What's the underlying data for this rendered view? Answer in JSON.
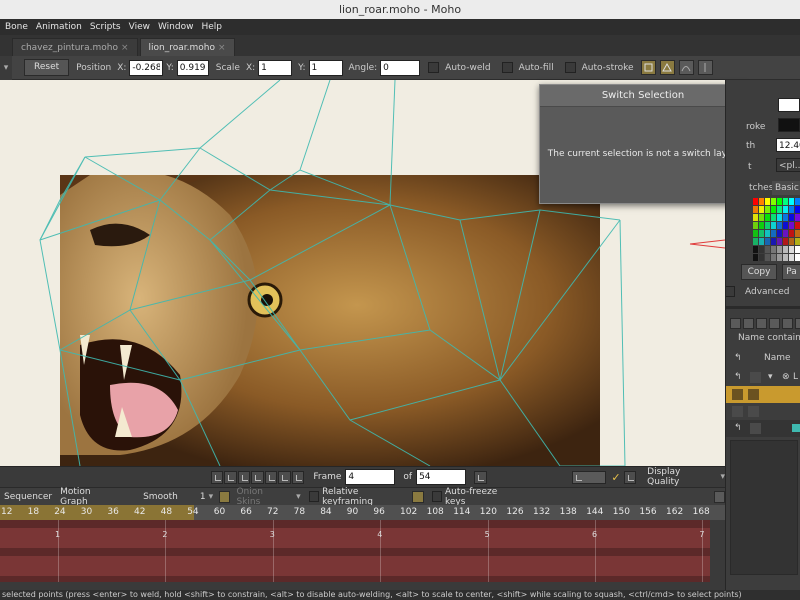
{
  "window": {
    "title": "lion_roar.moho - Moho"
  },
  "menu": [
    "Bone",
    "Animation",
    "Scripts",
    "View",
    "Window",
    "Help"
  ],
  "doc_tabs": [
    {
      "label": "chavez_pintura.moho",
      "active": false
    },
    {
      "label": "lion_roar.moho",
      "active": true
    }
  ],
  "tool_options": {
    "reset_label": "Reset",
    "position_label": "Position",
    "x_label": "X:",
    "position_x": "-0.2688",
    "y_label": "Y:",
    "position_y": "0.9199",
    "scale_label": "Scale",
    "scale_x": "1",
    "scale_y": "1",
    "angle_label": "Angle:",
    "angle": "0",
    "auto_weld": "Auto-weld",
    "auto_fill": "Auto-fill",
    "auto_stroke": "Auto-stroke"
  },
  "dialog": {
    "title": "Switch Selection",
    "message": "The current selection is not a switch layer.",
    "close_icon": "close-icon"
  },
  "style_panel": {
    "stroke_label": "roke",
    "width_label": "th",
    "width_value": "12.40",
    "effect_label": "t",
    "effect_value": "<pl...",
    "swatches_tab": "tches",
    "basic_colors_tab": "Basic C",
    "copy_button": "Copy",
    "paste_button": "Pa",
    "advanced_label": "Advanced"
  },
  "layers_panel": {
    "filter_label": "Name contains...",
    "name_header": "Name",
    "row_label": "L"
  },
  "playback": {
    "frame_label": "Frame",
    "frame_value": "4",
    "of_label": "of",
    "total_frames": "54",
    "display_quality": "Display Quality"
  },
  "timeline": {
    "tabs": [
      "Sequencer",
      "Motion Graph"
    ],
    "smooth_label": "Smooth",
    "smooth_value": "1",
    "onion_skins": "Onion Skins",
    "relative_keyframing": "Relative keyframing",
    "auto_freeze": "Auto-freeze keys",
    "ruler_played": [
      "12",
      "18",
      "24",
      "30",
      "36",
      "42",
      "48",
      "54"
    ],
    "ruler_rest": [
      "60",
      "66",
      "72",
      "78",
      "84",
      "90",
      "96",
      "102",
      "108",
      "114",
      "120",
      "126",
      "132",
      "138",
      "144",
      "150",
      "156",
      "162",
      "168"
    ],
    "track_marks": [
      "1",
      "2",
      "3",
      "4",
      "5",
      "6",
      "7"
    ]
  },
  "status": {
    "text": "selected points (press <enter> to weld, hold <shift> to constrain, <alt> to disable auto-welding, <alt> to scale to center, <shift> while scaling to squash, <ctrl/cmd> to select points)"
  },
  "colors": {
    "mesh": "#3fb9b0",
    "accent_gold": "#c99a2e",
    "track_red": "#7a3636",
    "canvas_bg": "#f1ede2",
    "dialog_close": "#c0392b"
  }
}
